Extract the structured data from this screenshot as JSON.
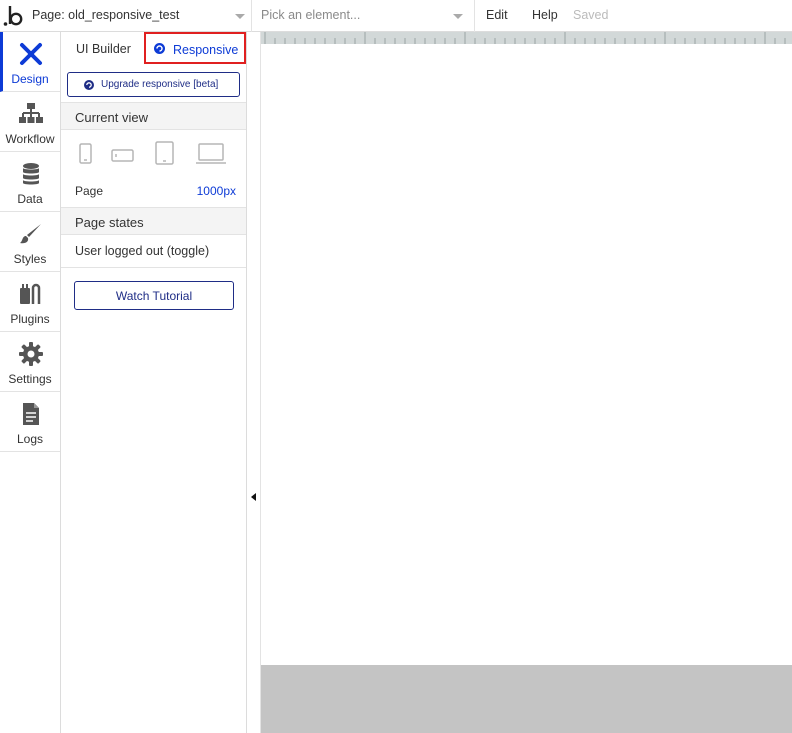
{
  "topbar": {
    "page_label": "Page: old_responsive_test",
    "element_placeholder": "Pick an element...",
    "edit": "Edit",
    "help": "Help",
    "status": "Saved"
  },
  "rail": {
    "items": [
      {
        "label": "Design",
        "icon": "design-icon",
        "active": true
      },
      {
        "label": "Workflow",
        "icon": "workflow-icon"
      },
      {
        "label": "Data",
        "icon": "database-icon"
      },
      {
        "label": "Styles",
        "icon": "brush-icon"
      },
      {
        "label": "Plugins",
        "icon": "plug-icon"
      },
      {
        "label": "Settings",
        "icon": "gear-icon"
      },
      {
        "label": "Logs",
        "icon": "document-icon"
      }
    ]
  },
  "panel": {
    "tabs": {
      "ui_builder": "UI Builder",
      "responsive": "Responsive"
    },
    "upgrade_button": "Upgrade responsive [beta]",
    "current_view": {
      "heading": "Current view",
      "devices": [
        "phone-portrait-icon",
        "phone-landscape-icon",
        "tablet-icon",
        "laptop-icon"
      ],
      "page_label": "Page",
      "page_value": "1000px"
    },
    "page_states": {
      "heading": "Page states",
      "items": [
        "User logged out (toggle)"
      ]
    },
    "tutorial_button": "Watch Tutorial"
  },
  "colors": {
    "accent": "#0d3bd6",
    "button_border": "#1f2d86",
    "highlight": "#e02020",
    "canvas_bottom": "#c4c4c4"
  }
}
